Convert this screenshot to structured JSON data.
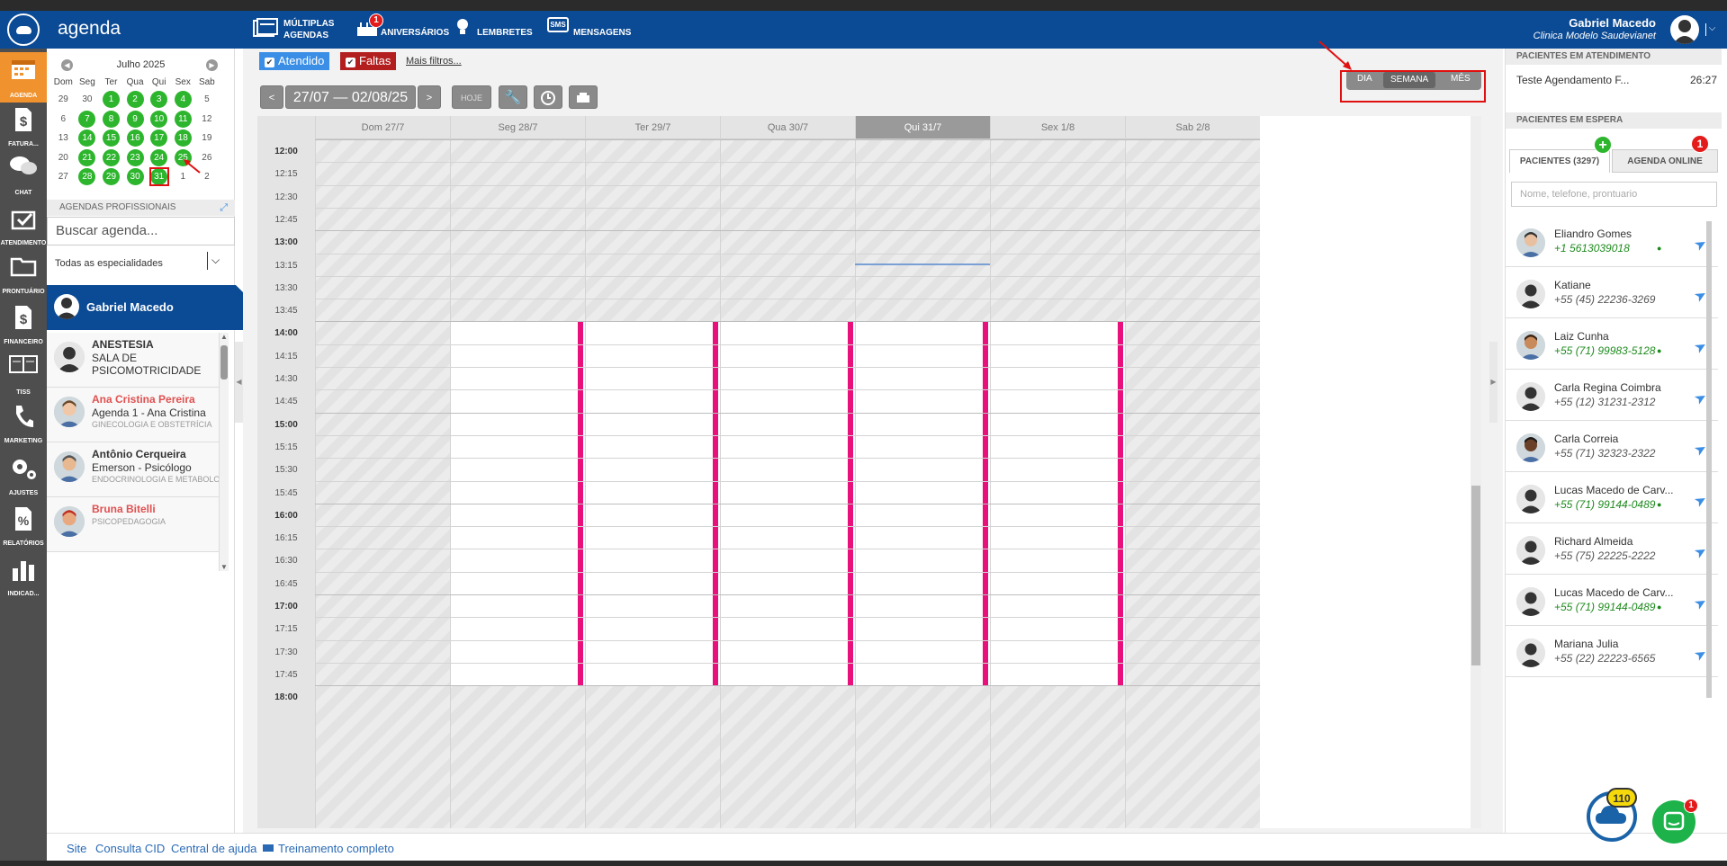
{
  "app": {
    "title": "agenda"
  },
  "topnav": [
    {
      "icon": "multiple-calendars-icon",
      "label1": "MÚLTIPLAS",
      "label2": "AGENDAS"
    },
    {
      "icon": "cake-icon",
      "label": "ANIVERSÁRIOS",
      "badge": "1"
    },
    {
      "icon": "lightbulb-icon",
      "label": "LEMBRETES"
    },
    {
      "icon": "sms-icon",
      "icon_text": "SMS",
      "label": "MENSAGENS"
    }
  ],
  "user": {
    "name": "Gabriel Macedo",
    "clinic": "Clinica Modelo Saudevianet"
  },
  "sidebar": {
    "items": [
      {
        "label": "AGENDA",
        "icon": "calendar-icon",
        "active": true
      },
      {
        "label": "FATURA...",
        "icon": "dollar-icon"
      },
      {
        "label": "CHAT",
        "icon": "chat-icon"
      },
      {
        "label": "ATENDIMENTO",
        "icon": "inbox-check-icon"
      },
      {
        "label": "PRONTUÁRIO",
        "icon": "folder-icon"
      },
      {
        "label": "FINANCEIRO",
        "icon": "dollar-icon"
      },
      {
        "label": "TISS",
        "icon": "tiss-icon"
      },
      {
        "label": "MARKETING",
        "icon": "phone-icon"
      },
      {
        "label": "AJUSTES",
        "icon": "gear-icon"
      },
      {
        "label": "RELATÓRIOS",
        "icon": "percent-icon"
      },
      {
        "label": "INDICAD...",
        "icon": "bar-chart-icon"
      }
    ]
  },
  "calendar": {
    "month": "Julho 2025",
    "weekdays": [
      "Dom",
      "Seg",
      "Ter",
      "Qua",
      "Qui",
      "Sex",
      "Sab"
    ],
    "weeks": [
      [
        {
          "d": "29"
        },
        {
          "d": "30"
        },
        {
          "d": "1",
          "g": true
        },
        {
          "d": "2",
          "g": true
        },
        {
          "d": "3",
          "g": true
        },
        {
          "d": "4",
          "g": true
        },
        {
          "d": "5"
        }
      ],
      [
        {
          "d": "6"
        },
        {
          "d": "7",
          "g": true
        },
        {
          "d": "8",
          "g": true
        },
        {
          "d": "9",
          "g": true
        },
        {
          "d": "10",
          "g": true
        },
        {
          "d": "11",
          "g": true
        },
        {
          "d": "12"
        }
      ],
      [
        {
          "d": "13"
        },
        {
          "d": "14",
          "g": true
        },
        {
          "d": "15",
          "g": true
        },
        {
          "d": "16",
          "g": true
        },
        {
          "d": "17",
          "g": true
        },
        {
          "d": "18",
          "g": true
        },
        {
          "d": "19"
        }
      ],
      [
        {
          "d": "20"
        },
        {
          "d": "21",
          "g": true
        },
        {
          "d": "22",
          "g": true
        },
        {
          "d": "23",
          "g": true
        },
        {
          "d": "24",
          "g": true
        },
        {
          "d": "25",
          "g": true
        },
        {
          "d": "26"
        }
      ],
      [
        {
          "d": "27"
        },
        {
          "d": "28",
          "g": true
        },
        {
          "d": "29",
          "g": true
        },
        {
          "d": "30",
          "g": true
        },
        {
          "d": "31",
          "g": true,
          "sel": true
        },
        {
          "d": "1"
        },
        {
          "d": "2"
        }
      ]
    ]
  },
  "agendas": {
    "header": "AGENDAS PROFISSIONAIS",
    "search_placeholder": "Buscar agenda...",
    "specialty": "Todas as especialidades",
    "selected": "Gabriel Macedo",
    "list": [
      {
        "name": "ANESTESIA",
        "sub": "SALA DE PSICOMOTRICIDADE",
        "tag": "",
        "red": false
      },
      {
        "name": "Ana Cristina Pereira",
        "sub": "Agenda 1 - Ana Cristina",
        "tag": "GINECOLOGIA E OBSTETRÍCIA",
        "red": true
      },
      {
        "name": "Antônio Cerqueira",
        "sub": "Emerson - Psicólogo",
        "tag": "ENDOCRINOLOGIA E METABOLOGIA",
        "red": false
      },
      {
        "name": "Bruna Bitelli",
        "sub": "",
        "tag": "PSICOPEDAGOGIA",
        "red": true
      }
    ]
  },
  "filters": {
    "attended": "Atendido",
    "missed": "Faltas",
    "more": "Mais filtros..."
  },
  "toolbar": {
    "prev": "<",
    "range": "27/07 — 02/08/25",
    "next": ">",
    "today": "HOJE"
  },
  "view": {
    "day": "DIA",
    "week": "SEMANA",
    "month": "MÊS",
    "active": "SEMANA"
  },
  "schedule": {
    "days": [
      "Dom 27/7",
      "Seg 28/7",
      "Ter 29/7",
      "Qua 30/7",
      "Qui 31/7",
      "Sex 1/8",
      "Sab 2/8"
    ],
    "today_index": 4,
    "times": [
      "12:00",
      "12:15",
      "12:30",
      "12:45",
      "13:00",
      "13:15",
      "13:30",
      "13:45",
      "14:00",
      "14:15",
      "14:30",
      "14:45",
      "15:00",
      "15:15",
      "15:30",
      "15:45",
      "16:00",
      "16:15",
      "16:30",
      "16:45",
      "17:00",
      "17:15",
      "17:30",
      "17:45",
      "18:00"
    ],
    "available_days": [
      1,
      2,
      3,
      4,
      5
    ],
    "available_from": "14:00",
    "available_to": "17:45",
    "now": "13:15"
  },
  "right": {
    "in_service_header": "PACIENTES EM ATENDIMENTO",
    "in_service": {
      "name": "Teste Agendamento F...",
      "time": "26:27"
    },
    "waiting_header": "PACIENTES EM ESPERA",
    "tab_patients": "PACIENTES (3297)",
    "tab_online": "AGENDA ONLINE",
    "tab_online_badge": "1",
    "search_placeholder": "Nome, telefone, prontuario",
    "patients": [
      {
        "name": "Eliandro Gomes",
        "phone": "+1 5613039018",
        "wa": true,
        "photo": "photo-man"
      },
      {
        "name": "Katiane",
        "phone": "+55 (45) 22236-3269",
        "wa": false,
        "photo": "silhouette"
      },
      {
        "name": "Laiz Cunha",
        "phone": "+55 (71) 99983-5128",
        "wa": true,
        "photo": "photo-woman"
      },
      {
        "name": "Carla Regina Coimbra",
        "phone": "+55 (12) 31231-2312",
        "wa": false,
        "photo": "silhouette"
      },
      {
        "name": "Carla Correia",
        "phone": "+55 (71) 32323-2322",
        "wa": false,
        "photo": "photo-woman2"
      },
      {
        "name": "Lucas Macedo de Carv...",
        "phone": "+55 (71) 99144-0489",
        "wa": true,
        "photo": "silhouette"
      },
      {
        "name": "Richard Almeida",
        "phone": "+55 (75) 22225-2222",
        "wa": false,
        "photo": "silhouette"
      },
      {
        "name": "Lucas Macedo de Carv...",
        "phone": "+55 (71) 99144-0489",
        "wa": true,
        "photo": "silhouette"
      },
      {
        "name": "Mariana Julia",
        "phone": "+55 (22) 22223-6565",
        "wa": false,
        "photo": "silhouette"
      }
    ]
  },
  "footer": {
    "links": [
      "Site",
      "Consulta CID",
      "Central de ajuda",
      "Treinamento completo"
    ]
  },
  "fab": {
    "notifications": "110",
    "chat_badge": "1"
  },
  "colors": {
    "brand": "#0b4a94",
    "green": "#2db52d",
    "pink": "#e8107a",
    "orange": "#f0922e",
    "annotation": "#e01010"
  }
}
